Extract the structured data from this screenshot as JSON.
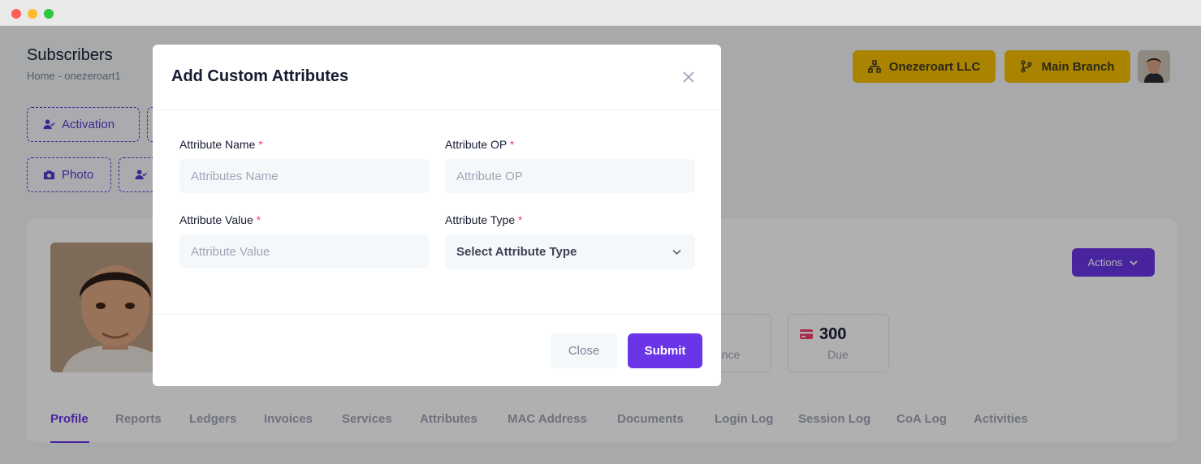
{
  "page": {
    "title": "Subscribers",
    "breadcrumb": "Home  -  onezeroart1"
  },
  "header": {
    "company_label": "Onezeroart LLC",
    "branch_label": "Main Branch"
  },
  "quick_actions": {
    "activation_label": "Activation",
    "photo_label": "Photo"
  },
  "profile_card": {
    "actions_label": "Actions",
    "due_value": "300",
    "due_label": "Due",
    "balance_label_partial": "ance"
  },
  "tabs": [
    "Profile",
    "Reports",
    "Ledgers",
    "Invoices",
    "Services",
    "Attributes",
    "MAC Address",
    "Documents",
    "Login Log",
    "Session Log",
    "CoA Log",
    "Activities"
  ],
  "modal": {
    "title": "Add Custom Attributes",
    "required_mark": "*",
    "attr_name_label": "Attribute Name",
    "attr_name_placeholder": "Attributes Name",
    "attr_op_label": "Attribute OP",
    "attr_op_placeholder": "Attribute OP",
    "attr_value_label": "Attribute Value",
    "attr_value_placeholder": "Attribute Value",
    "attr_type_label": "Attribute Type",
    "attr_type_selected": "Select Attribute Type",
    "close_label": "Close",
    "submit_label": "Submit"
  },
  "colors": {
    "accent": "#6a35e6",
    "header_button": "#f6c000",
    "required": "#f1416c"
  }
}
